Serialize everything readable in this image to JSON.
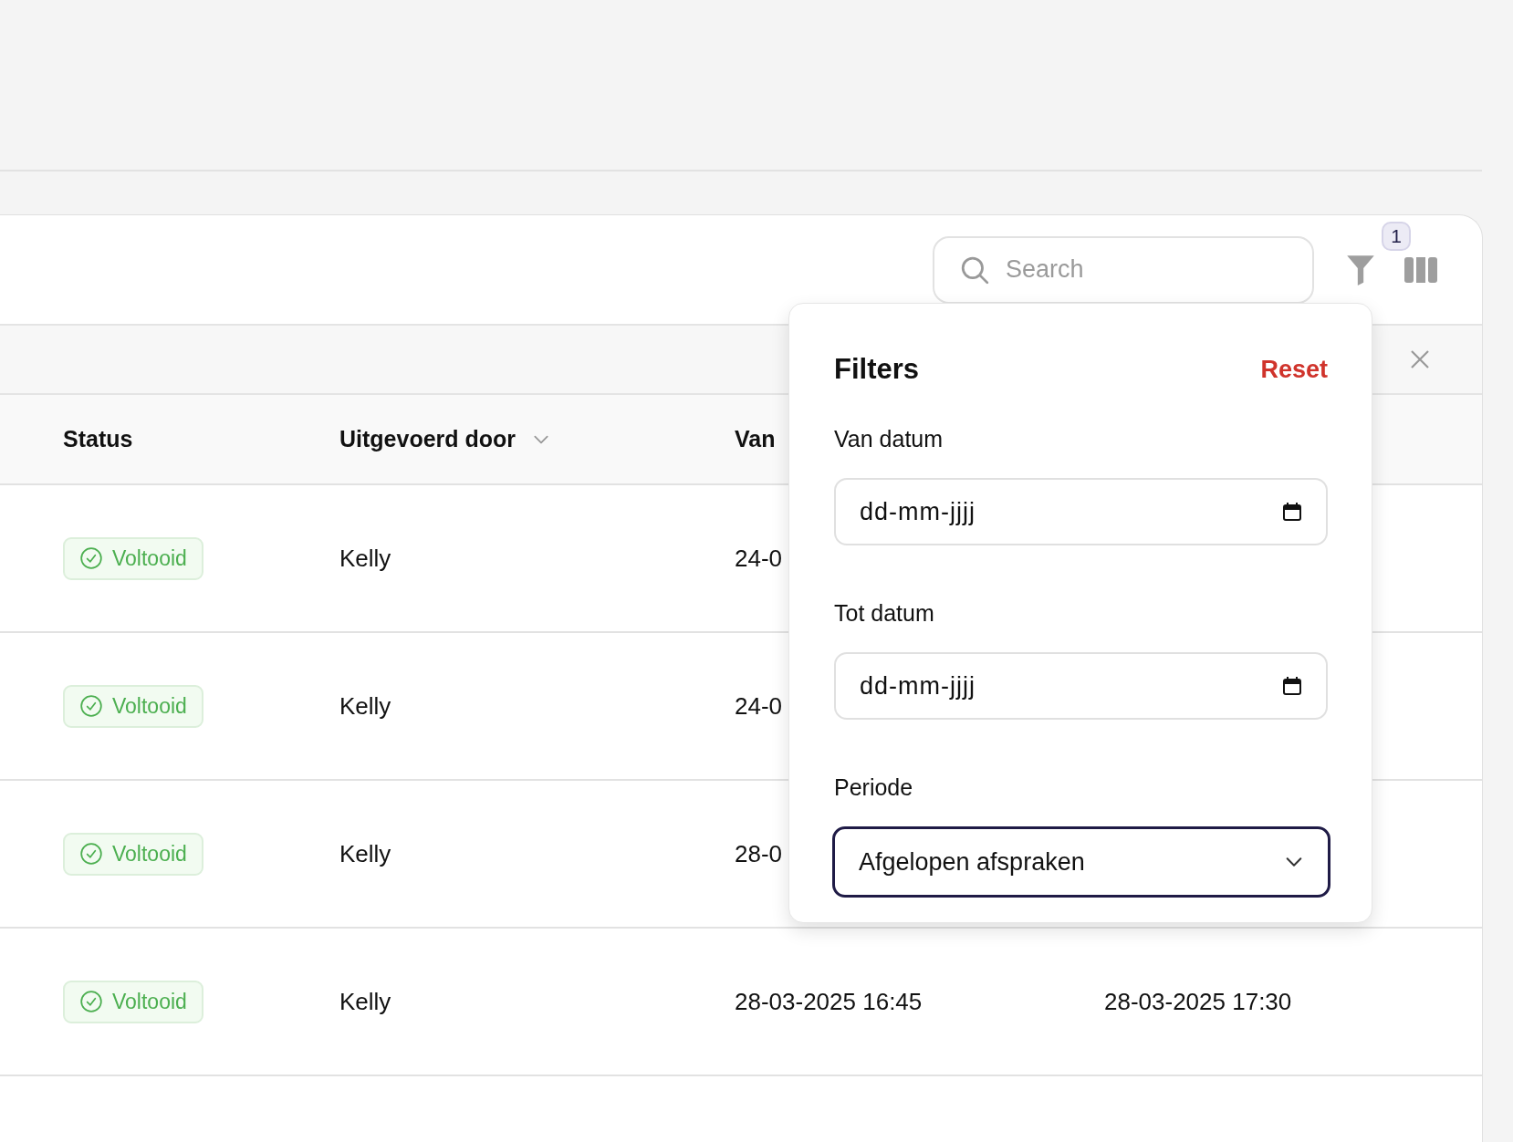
{
  "toolbar": {
    "search": {
      "placeholder": "Search"
    },
    "filter_badge": "1"
  },
  "table": {
    "columns": [
      {
        "label": "Status",
        "kind": "plain"
      },
      {
        "label": "Uitgevoerd door",
        "kind": "dropdown"
      },
      {
        "label": "Van",
        "kind": "plain"
      }
    ],
    "rows": [
      {
        "status": "Voltooid",
        "performed_by": "Kelly",
        "van": "24-0"
      },
      {
        "status": "Voltooid",
        "performed_by": "Kelly",
        "van": "24-0"
      },
      {
        "status": "Voltooid",
        "performed_by": "Kelly",
        "van": "28-0"
      },
      {
        "status": "Voltooid",
        "performed_by": "Kelly",
        "van": "28-03-2025 16:45",
        "tot": "28-03-2025 17:30"
      }
    ]
  },
  "filters": {
    "title": "Filters",
    "reset": "Reset",
    "fields": [
      {
        "label": "Van datum",
        "kind": "date",
        "placeholder": "dd-mm-jjjj",
        "focused": false
      },
      {
        "label": "Tot datum",
        "kind": "date",
        "placeholder": "dd-mm-jjjj",
        "focused": false
      },
      {
        "label": "Periode",
        "kind": "select",
        "value": "Afgelopen afspraken",
        "focused": true
      }
    ]
  }
}
